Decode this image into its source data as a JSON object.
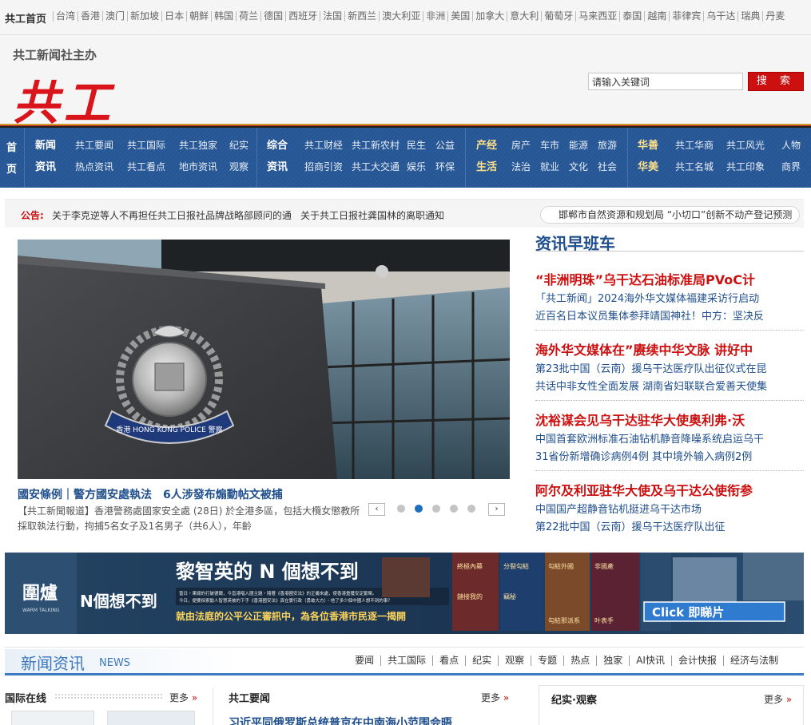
{
  "topbar": {
    "home": "共工首页",
    "regions": [
      "台湾",
      "香港",
      "澳门",
      "新加坡",
      "日本",
      "朝鲜",
      "韩国",
      "荷兰",
      "德国",
      "西班牙",
      "法国",
      "新西兰",
      "澳大利亚",
      "非洲",
      "美国",
      "加拿大",
      "意大利",
      "葡萄牙",
      "马来西亚",
      "泰国",
      "越南",
      "菲律宾",
      "乌干达",
      "瑞典",
      "丹麦"
    ]
  },
  "header": {
    "sponsor": "共工新闻社主办",
    "logo": "共工",
    "search_placeholder": "请输入关键词",
    "search_button": "搜 索"
  },
  "nav": {
    "home": "首页",
    "groups": [
      {
        "cats": [
          "新闻",
          "资讯"
        ],
        "row1": [
          "共工要闻",
          "共工国际",
          "共工独家",
          "纪实"
        ],
        "row2": [
          "热点资讯",
          "共工看点",
          "地市资讯",
          "观察"
        ]
      },
      {
        "cats": [
          "综合",
          "资讯"
        ],
        "row1": [
          "共工财经",
          "共工新农村",
          "民生",
          "公益"
        ],
        "row2": [
          "招商引资",
          "共工大交通",
          "娱乐",
          "环保"
        ]
      },
      {
        "cats": [
          "产经",
          "生活"
        ],
        "row1": [
          "房产",
          "车市",
          "能源",
          "旅游"
        ],
        "row2": [
          "法治",
          "就业",
          "文化",
          "社会"
        ]
      },
      {
        "cats": [
          "华善",
          "华美"
        ],
        "row1": [
          "共工华商",
          "共工风光",
          "人物"
        ],
        "row2": [
          "共工名城",
          "共工印象",
          "商界"
        ]
      }
    ]
  },
  "notice": {
    "label": "公告:",
    "items": [
      "关于李克逆等人不再担任共工日报社品牌战略部顾问的通",
      "关于共工日报社龚国林的离职通知"
    ],
    "scroll": "邯郸市自然资源和规划局 “小切口”创新不动产登记预测"
  },
  "hero": {
    "title": "國安條例｜警方國安處執法　6人涉發布煽動帖文被捕",
    "desc": "【共工新聞報道】香港警務處國家安全處 (28日) 於全港多區，包括大欖女懲教所採取執法行動，拘捕5名女子及1名男子（共6人），年齡",
    "emblem_lettering": "香港 HONG KONG POLICE 警察",
    "prev": "‹",
    "next": "›",
    "slides": 5,
    "active_slide": 2
  },
  "express": {
    "title": "资讯早班车",
    "blocks": [
      {
        "headline": "“非洲明珠”乌干达石油标准局PVoC计",
        "subs": [
          "「共工新闻」2024海外华文媒体福建采访行启动",
          "近百名日本议员集体参拜靖国神社！中方：坚决反"
        ]
      },
      {
        "headline": "海外华文媒体在”赓续中华文脉 讲好中",
        "subs": [
          "第23批中国（云南）援乌干达医疗队出征仪式在昆",
          "共话中非女性全面发展 湖南省妇联联合爱善天使集"
        ]
      },
      {
        "headline": "沈裕谋会见乌干达驻华大使奥利弗·沃",
        "subs": [
          "中国首套欧洲标准石油钻机静音降噪系统启运乌干",
          "31省份新增确诊病例4例 其中境外输入病例2例"
        ]
      },
      {
        "headline": "阿尔及利亚驻华大使及乌干达公使衔参",
        "subs": [
          "中国国产超静音钻机挺进乌干达市场",
          "第22批中国（云南）援乌干达医疗队出征"
        ]
      }
    ]
  },
  "banner": {
    "logo_cn": "圍爐",
    "logo_en": "WARM TALKING",
    "badge": "N個想不到",
    "headline": "黎智英的 N 個想不到",
    "small1": "曾日・果總的打破德爾，今直港唱入國主題・隨著《香港國安法》的正義來處，使香港重獲安定繁榮。",
    "small2": "今日，便要探索動人智慧英被的下手《香港國安法》真在實行政（勇敢大方）・他了多少個中國人想不到的事？",
    "tagline": "就由法庭的公平公正審訊中，為各位香港市民逐一揭開",
    "cta": "Click 即睇片",
    "thumbs": [
      "終極內幕",
      "分裂勾結",
      "勾結外國",
      "非國產",
      "鏈接我的",
      "竊秘",
      "勾結那派系",
      "叶表手"
    ]
  },
  "section": {
    "title": "新闻资讯",
    "en": "NEWS",
    "links": [
      "要闻",
      "共工国际",
      "看点",
      "纪实",
      "观察",
      "专题",
      "热点",
      "独家",
      "AI快讯",
      "会计快报",
      "经济与法制"
    ]
  },
  "columns": {
    "intl": "国际在线",
    "top": "共工要闻",
    "obs": "纪实·观察",
    "more": "更多",
    "more_arrow": "»",
    "top_first": "习近平同俄罗斯总统普京在中南海小范围会晤"
  },
  "colors": {
    "brand_red": "#cc1010",
    "nav_blue": "#245594",
    "link_blue": "#1f4e8c",
    "accent_blue": "#3b78bf"
  }
}
